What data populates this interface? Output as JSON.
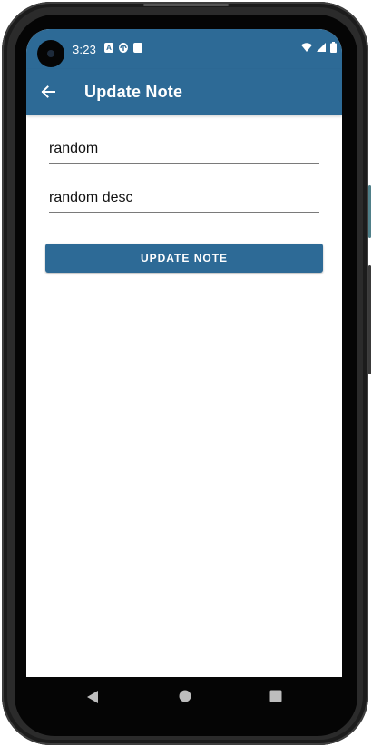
{
  "status_bar": {
    "time": "3:23",
    "left_icons": [
      "a-notification-icon",
      "sync-icon",
      "sd-card-icon"
    ],
    "right_icons": [
      "wifi-icon",
      "signal-icon",
      "battery-icon"
    ],
    "background_color": "#2d6a96"
  },
  "app_bar": {
    "title": "Update Note",
    "back_icon": "arrow-left-icon",
    "background_color": "#2d6a96"
  },
  "form": {
    "title_value": "random",
    "description_value": "random desc",
    "update_label": "UPDATE NOTE",
    "button_color": "#2d6a96"
  },
  "navigation": {
    "buttons": [
      "back-triangle-icon",
      "home-circle-icon",
      "recents-square-icon"
    ]
  }
}
